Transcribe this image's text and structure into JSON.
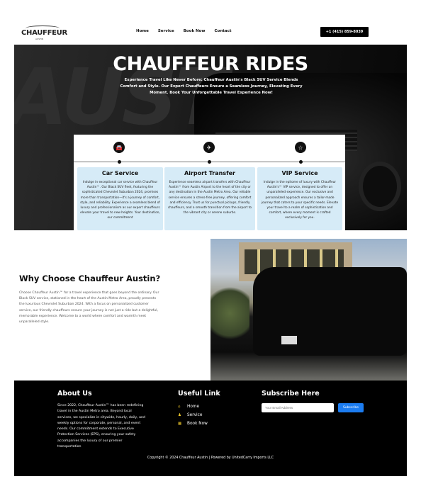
{
  "header": {
    "logo_text": "CHAUFFEUR",
    "logo_sub": "AUSTIN",
    "nav": [
      "Home",
      "Service",
      "Book Now",
      "Contact"
    ],
    "phone": "+1 (415) 859-8039"
  },
  "hero": {
    "title": "CHAUFFEUR RIDES",
    "subtitle": "Experience Travel Like Never Before: Chauffeur Austin's Black SUV Service Blends Comfort and Style. Our Expert Chauffeurs Ensure a Seamless Journey, Elevating Every Moment. Book Your Unforgettable Travel Experience Now!"
  },
  "services": [
    {
      "icon": "car-icon",
      "title": "Car Service",
      "text": "Indulge in exceptional car service with Chauffeur Austin™. Our Black SUV fleet, featuring the sophisticated Chevrolet Suburban 2024, promises more than transportation—it's a journey of comfort, style, and reliability. Experience a seamless blend of luxury and professionalism as our expert chauffeurs elevate your travel to new heights. Your destination, our commitment"
    },
    {
      "icon": "airplane-icon",
      "title": "Airport Transfer",
      "text": "Experience seamless airport transfers with Chauffeur Austin™ from Austin Airport to the heart of the city or any destination in the Austin Metro Area. Our reliable service ensures a stress-free journey, offering comfort and efficiency. Trust us for punctual pickups, friendly chauffeurs, and a smooth transition from the airport to the vibrant city or serene suburbs."
    },
    {
      "icon": "star-icon",
      "title": "VIP Service",
      "text": "Indulge in the epitome of luxury with Chauffeur Austin's™ VIP service, designed to offer an unparalleled experience. Our exclusive and personalized approach ensures a tailor-made journey that caters to your specific needs. Elevate your travel to a realm of sophistication and comfort, where every moment is crafted exclusively for you."
    }
  ],
  "why": {
    "title": "Why Choose Chauffeur Austin?",
    "text": "Choose Chauffeur Austin™ for a travel experience that goes beyond the ordinary. Our Black SUV service, stationed in the heart of the Austin Metro Area, proudly presents the luxurious Chevrolet Suburban 2024. With a focus on personalized customer service, our friendly chauffeurs ensure your journey is not just a ride but a delightful, memorable experience. Welcome to a world where comfort and warmth meet unparalleled style."
  },
  "footer": {
    "about_title": "About Us",
    "about_text": "Since 2022, Chauffeur Austin™ has been redefining travel in the Austin Metro area. Beyond local services, we specialize in citywide, hourly, daily, and weekly options for corporate, personal, and event needs. Our commitment extends to Executive Protection Services (EPS), ensuring your safety accompanies the luxury of our premier transportation",
    "links_title": "Useful Link",
    "links": [
      "Home",
      "Service",
      "Book Now"
    ],
    "subscribe_title": "Subscribe Here",
    "email_placeholder": "Your Email Address",
    "subscribe_button": "Subscribe",
    "copyright": "Copyright © 2024 Chauffeur Austin | Powered by  UnitedCarry Imports LLC"
  },
  "colors": {
    "accent": "#1c7cf0",
    "card_bg": "#d6ebf7",
    "link_icon": "#e8c32a"
  }
}
